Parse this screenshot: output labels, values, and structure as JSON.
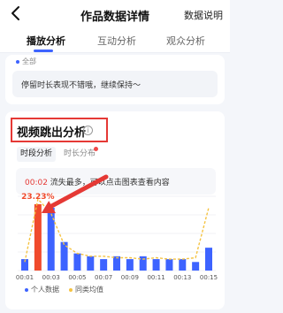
{
  "header": {
    "title": "作品数据详情",
    "explain_label": "数据说明",
    "back_icon": "chevron-left-icon"
  },
  "tabs": [
    {
      "label": "播放分析",
      "active": true
    },
    {
      "label": "互动分析",
      "active": false
    },
    {
      "label": "观众分析",
      "active": false
    }
  ],
  "overview": {
    "legend_all": "全部",
    "tip": "停留时长表现不错哦，继续保持～"
  },
  "section": {
    "title": "视频跳出分析",
    "info_icon": "info-icon"
  },
  "subtabs": [
    {
      "label": "时段分析",
      "active": true
    },
    {
      "label": "时长分布",
      "active": false
    }
  ],
  "summary": {
    "time": "00:02",
    "text": " 流失最多，可以点击图表查看内容"
  },
  "colors": {
    "accent": "#3d63ff",
    "highlight": "#f04a2c",
    "average_line": "#f5c342",
    "annotation": "#e53935"
  },
  "chart_data": {
    "type": "bar",
    "x": [
      "00:01",
      "00:02",
      "00:03",
      "00:04",
      "00:05",
      "00:06",
      "00:07",
      "00:08",
      "00:09",
      "00:10",
      "00:11",
      "00:12",
      "00:13",
      "00:14",
      "00:15"
    ],
    "tick_labels": [
      "00:01",
      "00:03",
      "00:05",
      "00:07",
      "00:09",
      "00:11",
      "00:13",
      "00:15"
    ],
    "series": [
      {
        "name": "个人数据",
        "kind": "bar",
        "values": [
          4,
          23.23,
          22,
          10,
          6,
          5,
          4,
          5,
          4,
          5,
          4,
          4,
          4,
          3,
          8
        ]
      },
      {
        "name": "同类均值",
        "kind": "line",
        "style": "dashed",
        "values": [
          3,
          25,
          20,
          9,
          6,
          5,
          5,
          4.5,
          4.5,
          4,
          4.5,
          4,
          4,
          4.5,
          22
        ]
      }
    ],
    "highlight_index": 1,
    "highlight_label": "23.23%",
    "ylim": [
      0,
      26
    ],
    "grid": true
  }
}
